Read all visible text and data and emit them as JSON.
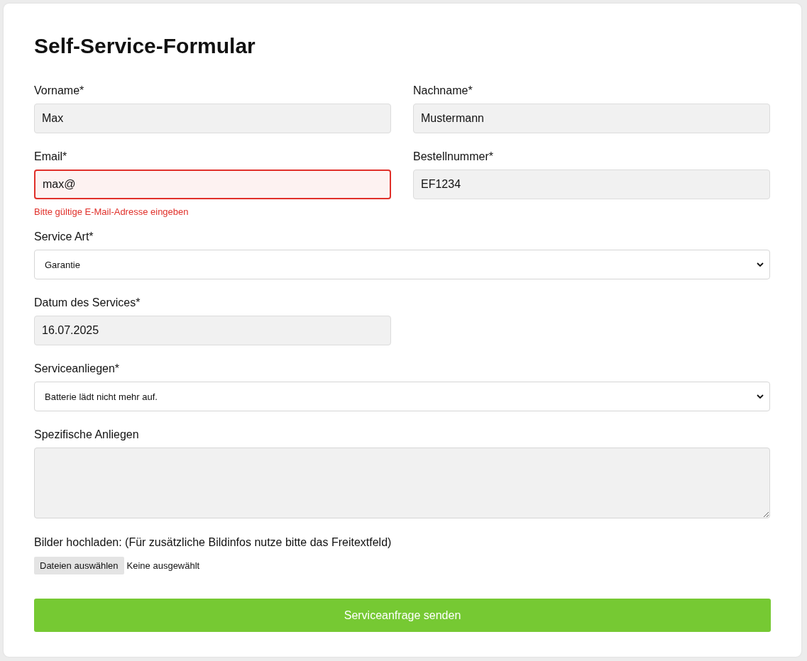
{
  "title": "Self-Service-Formular",
  "fields": [
    {
      "kind": "text",
      "label": "Vorname*",
      "value": "Max",
      "invalid": false
    },
    {
      "kind": "text",
      "label": "Nachname*",
      "value": "Mustermann",
      "invalid": false
    },
    {
      "kind": "text",
      "label": "Email*",
      "value": "max@",
      "invalid": true,
      "error": "Bitte gültige E-Mail-Adresse eingeben"
    },
    {
      "kind": "text",
      "label": "Bestellnummer*",
      "value": "EF1234",
      "invalid": false
    },
    {
      "kind": "select",
      "label": "Service Art*",
      "value": "Garantie"
    },
    {
      "kind": "text",
      "label": "Datum des Services*",
      "value": "16.07.2025",
      "invalid": false
    },
    {
      "kind": "select",
      "label": "Serviceanliegen*",
      "value": "Batterie lädt nicht mehr auf."
    },
    {
      "kind": "textarea",
      "label": "Spezifische Anliegen"
    }
  ],
  "upload": {
    "label": "Bilder hochladen: (Für zusätzliche Bildinfos nutze bitte das Freitextfeld)",
    "button": "Dateien auswählen",
    "status": "Keine ausgewählt"
  },
  "submit": "Serviceanfrage senden"
}
